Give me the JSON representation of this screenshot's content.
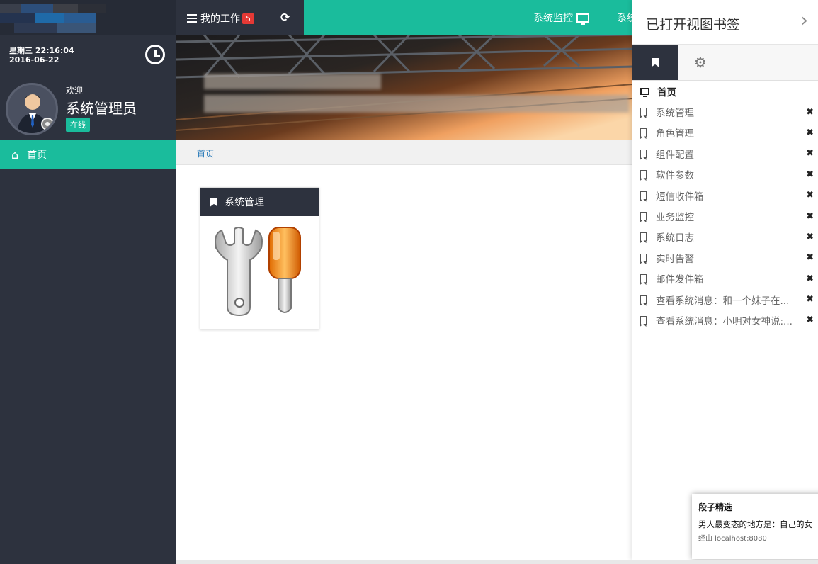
{
  "topbar": {
    "my_work_label": "我的工作",
    "my_work_badge": "5",
    "refresh_icon": "refresh-icon",
    "system_monitor_label": "系统监控",
    "truncated_menu_label": "系统"
  },
  "sidebar": {
    "date_line": "星期三 22:16:04",
    "date_day": "2016-06-22",
    "welcome": "欢迎",
    "username": "系统管理员",
    "status": "在线",
    "nav_home": "首页"
  },
  "breadcrumb": {
    "home": "首页"
  },
  "card": {
    "title": "系统管理"
  },
  "right_panel": {
    "title": "已打开视图书签",
    "home_item": "首页",
    "items": [
      "系统管理",
      "角色管理",
      "组件配置",
      "软件参数",
      "短信收件箱",
      "业务监控",
      "系统日志",
      "实时告警",
      "邮件发件箱",
      "查看系统消息：和一个妹子在...",
      "查看系统消息：小明对女神说:..."
    ],
    "close_glyph": "✖"
  },
  "toast": {
    "title": "段子精选",
    "body": "男人最变态的地方是：自己的女",
    "source": "经由 localhost:8080"
  },
  "colors": {
    "accent": "#1abc9c",
    "sidebar_bg": "#2d323e",
    "badge": "#e53935"
  }
}
